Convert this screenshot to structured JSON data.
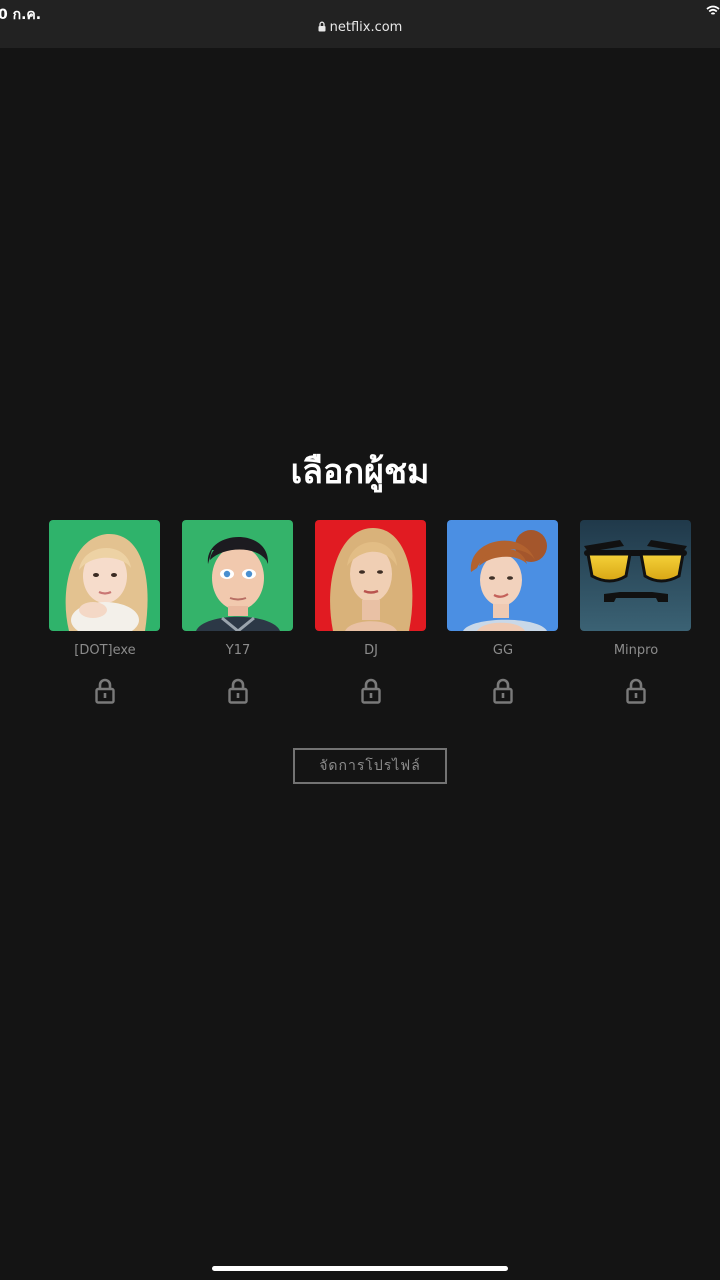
{
  "status_bar": {
    "time": "0 ก.ค.",
    "wifi_icon": "wifi-icon"
  },
  "browser": {
    "url": "netflix.com",
    "lock_icon": "lock-icon"
  },
  "page": {
    "title": "เลือกผู้ชม",
    "manage_label": "จัดการโปรไฟล์"
  },
  "profiles": [
    {
      "name": "[DOT]exe",
      "bg": "#2fb36b",
      "locked": true
    },
    {
      "name": "Y17",
      "bg": "#34b36a",
      "locked": true
    },
    {
      "name": "DJ",
      "bg": "#e11b22",
      "locked": true
    },
    {
      "name": "GG",
      "bg": "#4b8fe3",
      "locked": true
    },
    {
      "name": "Minpro",
      "bg": "#2d4d5e",
      "locked": true
    }
  ],
  "colors": {
    "background": "#141414",
    "status_bar": "#222222",
    "muted_text": "#8c8c8c",
    "button_border": "#737373"
  }
}
